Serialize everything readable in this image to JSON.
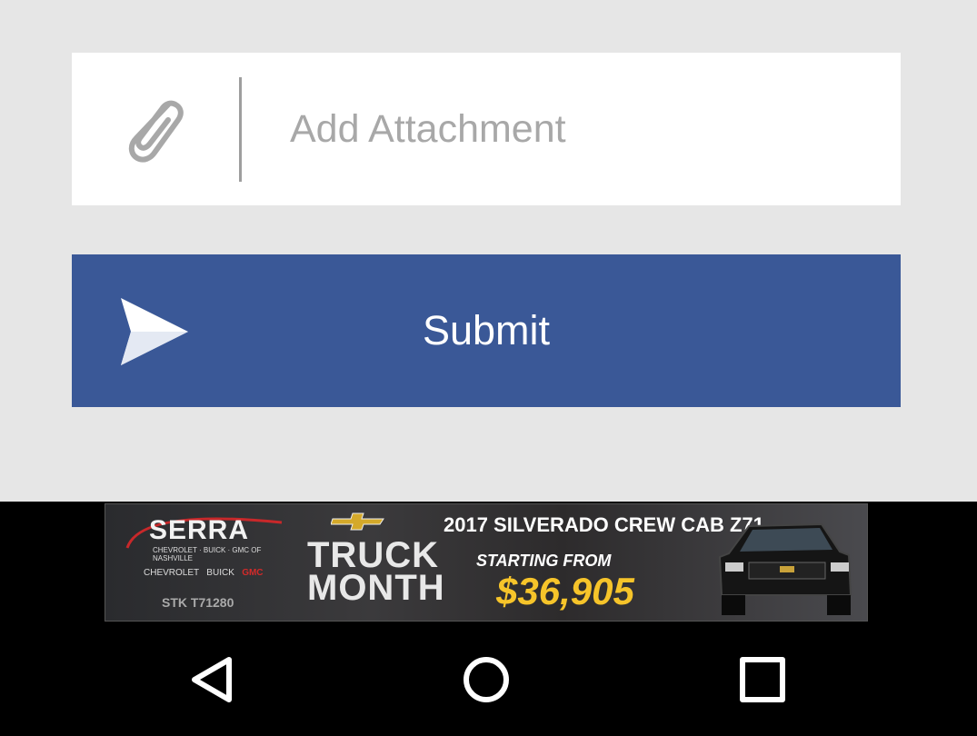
{
  "form": {
    "attachment_label": "Add Attachment",
    "submit_label": "Submit",
    "colors": {
      "page_background": "#e6e6e6",
      "submit_background": "#3a5897",
      "placeholder_text": "#a8a8a8"
    }
  },
  "ad": {
    "dealer": "SERRA",
    "dealer_sub": "CHEVROLET · BUICK · GMC OF NASHVILLE",
    "brand_chevrolet": "CHEVROLET",
    "brand_buick": "BUICK",
    "brand_gmc": "GMC",
    "stock": "STK T71280",
    "headline_1": "TRUCK",
    "headline_2": "MONTH",
    "model": "2017 SILVERADO CREW CAB Z71",
    "starting_from": "STARTING FROM",
    "price": "$36,905",
    "colors": {
      "price": "#f6c42a"
    }
  },
  "nav": {
    "back_icon": "back-triangle-icon",
    "home_icon": "home-circle-icon",
    "recents_icon": "recents-square-icon"
  }
}
